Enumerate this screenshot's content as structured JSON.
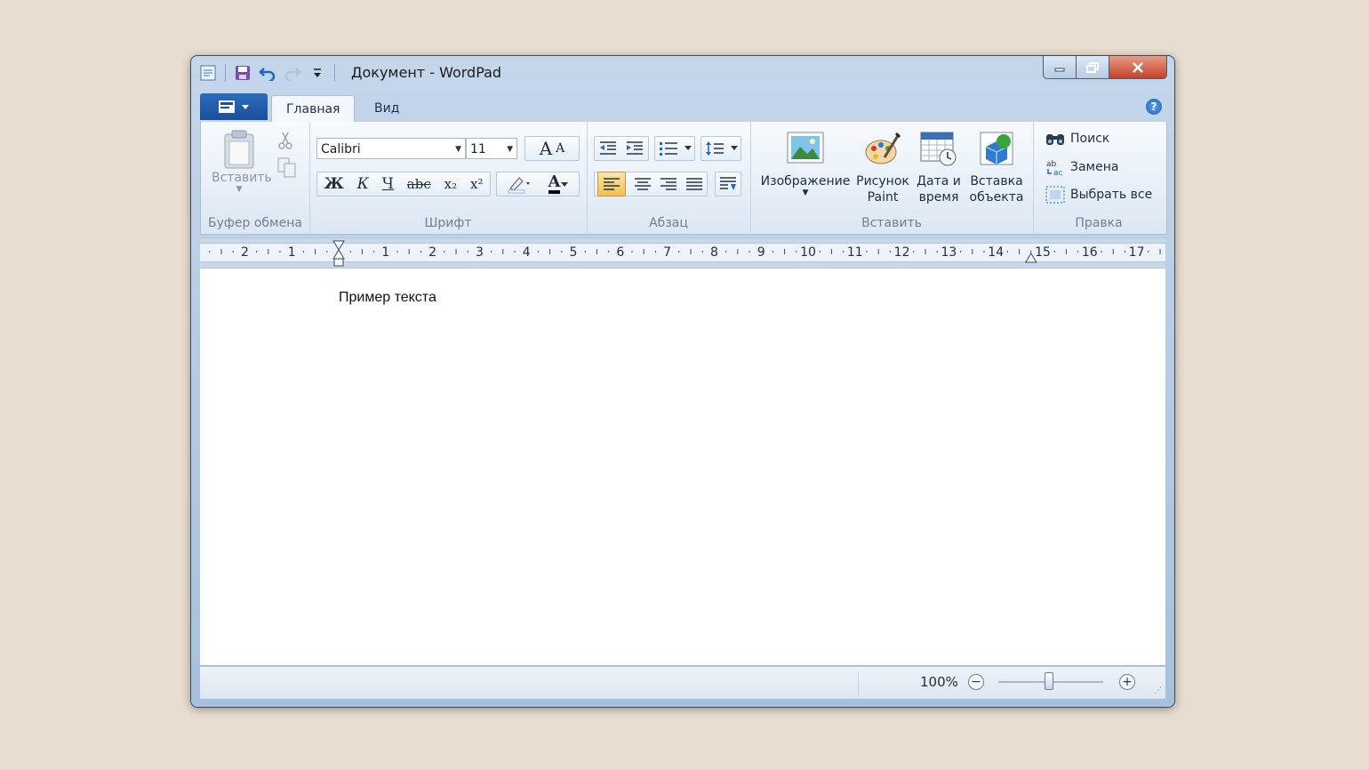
{
  "window": {
    "title": "Документ - WordPad",
    "icons": {
      "app": "wordpad-icon",
      "save": "save-icon",
      "undo": "undo-icon",
      "redo": "redo-icon",
      "customize": "qat-dropdown-icon"
    },
    "buttons": {
      "minimize": "minimize-icon",
      "maximize": "maximize-icon",
      "close": "close-icon"
    }
  },
  "tabs": [
    {
      "label": "Главная",
      "active": true
    },
    {
      "label": "Вид",
      "active": false
    }
  ],
  "ribbon": {
    "clipboard": {
      "label": "Буфер обмена",
      "paste": "Вставить"
    },
    "font": {
      "label": "Шрифт",
      "family": "Calibri",
      "size": "11",
      "bold": "Ж",
      "italic": "К",
      "underline": "Ч",
      "strike": "abc",
      "subscript": "x₂",
      "superscript": "x²",
      "grow": "A",
      "shrink": "A",
      "color_letter": "A"
    },
    "paragraph": {
      "label": "Абзац"
    },
    "insert": {
      "label": "Вставить",
      "image": "Изображение",
      "paint_1": "Рисунок",
      "paint_2": "Paint",
      "date_1": "Дата и",
      "date_2": "время",
      "object_1": "Вставка",
      "object_2": "объекта"
    },
    "editing": {
      "label": "Правка",
      "find": "Поиск",
      "replace": "Замена",
      "select_all": "Выбрать все"
    }
  },
  "ruler": {
    "labels": [
      "2",
      "1",
      "1",
      "2",
      "3",
      "4",
      "5",
      "6",
      "7",
      "8",
      "9",
      "10",
      "11",
      "12",
      "13",
      "14",
      "15",
      "16",
      "17"
    ]
  },
  "document": {
    "text": "Пример текста"
  },
  "status": {
    "zoom": "100%"
  },
  "colors": {
    "accent": "#1b4f9c",
    "selected": "#f6be4c",
    "close": "#c4412a"
  }
}
